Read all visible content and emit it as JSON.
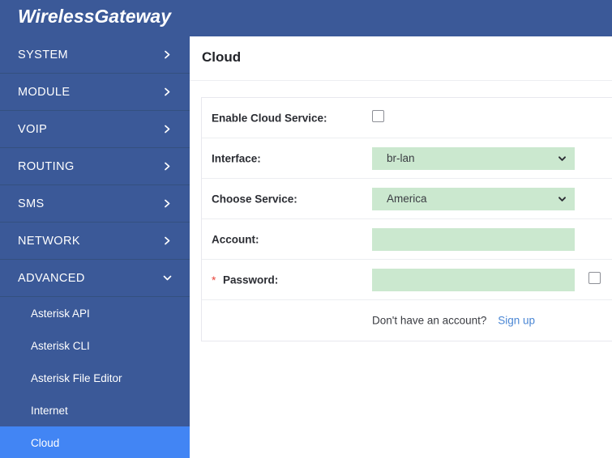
{
  "header": {
    "brand_title": "WirelessGateway",
    "brand_color": "#3b5998"
  },
  "sidebar": {
    "background_color": "#3b5998",
    "active_color": "#4285f4",
    "items": [
      {
        "label": "SYSTEM",
        "icon": "chevron-right-icon",
        "expanded": false
      },
      {
        "label": "MODULE",
        "icon": "chevron-right-icon",
        "expanded": false
      },
      {
        "label": "VOIP",
        "icon": "chevron-right-icon",
        "expanded": false
      },
      {
        "label": "ROUTING",
        "icon": "chevron-right-icon",
        "expanded": false
      },
      {
        "label": "SMS",
        "icon": "chevron-right-icon",
        "expanded": false
      },
      {
        "label": "NETWORK",
        "icon": "chevron-right-icon",
        "expanded": false
      },
      {
        "label": "ADVANCED",
        "icon": "chevron-down-icon",
        "expanded": true
      }
    ],
    "submenu": [
      {
        "label": "Asterisk API",
        "active": false
      },
      {
        "label": "Asterisk CLI",
        "active": false
      },
      {
        "label": "Asterisk File Editor",
        "active": false
      },
      {
        "label": "Internet",
        "active": false
      },
      {
        "label": "Cloud",
        "active": true
      }
    ]
  },
  "main": {
    "page_title": "Cloud",
    "form": {
      "enable_cloud_service": {
        "label": "Enable Cloud Service:",
        "checked": false
      },
      "interface": {
        "label": "Interface:",
        "value": "br-lan",
        "icon": "chevron-down-icon"
      },
      "choose_service": {
        "label": "Choose Service:",
        "value": "America",
        "icon": "chevron-down-icon"
      },
      "account": {
        "label": "Account:",
        "value": "",
        "placeholder": ""
      },
      "password": {
        "label": "Password:",
        "required_marker": "*",
        "value": "",
        "placeholder": "",
        "show_password_checked": false
      },
      "signup": {
        "prompt": "Don't have an account?",
        "link_label": "Sign up",
        "link_color": "#4a86d4"
      },
      "field_bg_color": "#cbe8cf"
    }
  }
}
